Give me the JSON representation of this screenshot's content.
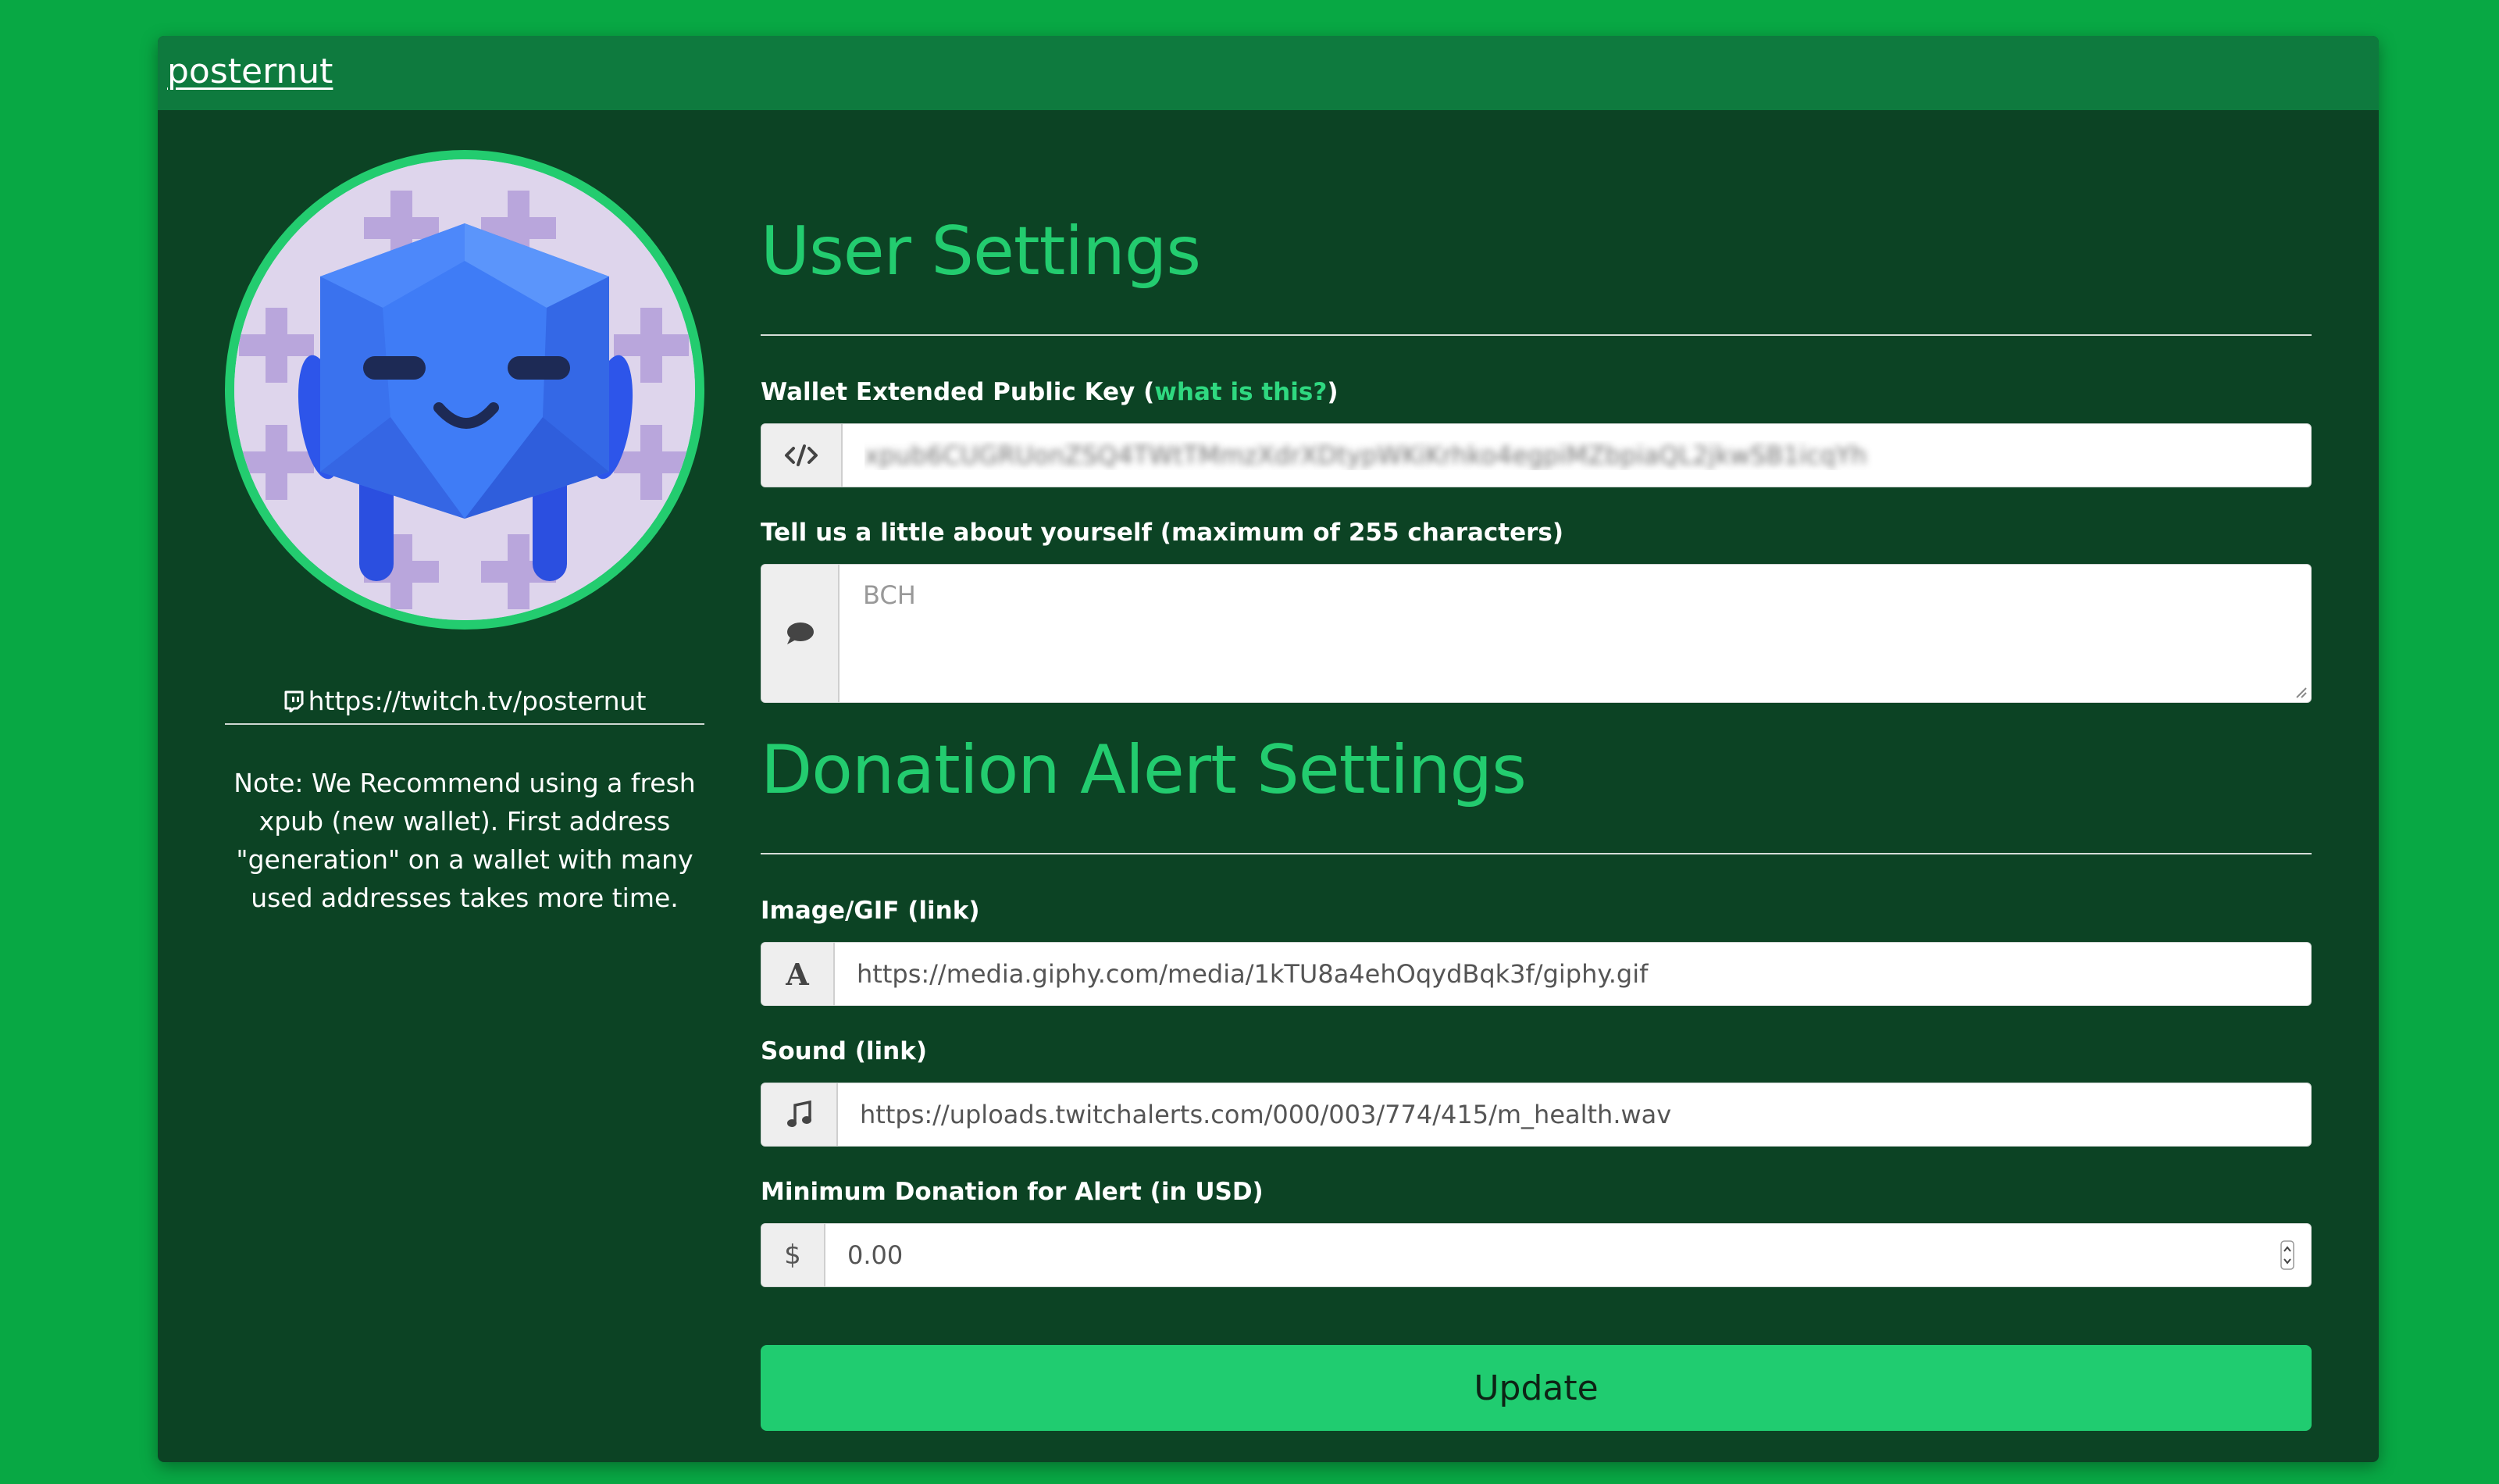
{
  "header": {
    "brand": "posternut"
  },
  "profile": {
    "twitch_url": "https://twitch.tv/posternut",
    "note": "Note: We Recommend using a fresh xpub (new wallet). First address \"generation\" on a wallet with many used addresses takes more time."
  },
  "user_settings": {
    "title": "User Settings",
    "xpub": {
      "label": "Wallet Extended Public Key (",
      "help_link": "what is this?",
      "label_close": ")",
      "value": "xpub6CUGRUonZSQ4TWtTMmzXdrXDtypWKiKrhko4egpiMZbpiaQL2jkwSB1icqYh"
    },
    "about": {
      "label": "Tell us a little about yourself (maximum of 255 characters)",
      "placeholder": "BCH"
    }
  },
  "donation_settings": {
    "title": "Donation Alert Settings",
    "image": {
      "label": "Image/GIF (link)",
      "value": "https://media.giphy.com/media/1kTU8a4ehOqydBqk3f/giphy.gif"
    },
    "sound": {
      "label": "Sound (link)",
      "value": "https://uploads.twitchalerts.com/000/003/774/415/m_health.wav"
    },
    "minimum": {
      "label": "Minimum Donation for Alert (in USD)",
      "currency_symbol": "$",
      "value": "0.00"
    }
  },
  "actions": {
    "update_label": "Update"
  },
  "colors": {
    "background": "#08a844",
    "panel": "#0c4324",
    "header": "#0e7a3e",
    "accent": "#23cc6f",
    "button": "#20cc70"
  },
  "icons": {
    "xpub_addon": "code-icon",
    "about_addon": "speech-bubble-icon",
    "image_addon": "font-icon",
    "sound_addon": "music-note-icon",
    "twitch": "twitch-icon"
  }
}
